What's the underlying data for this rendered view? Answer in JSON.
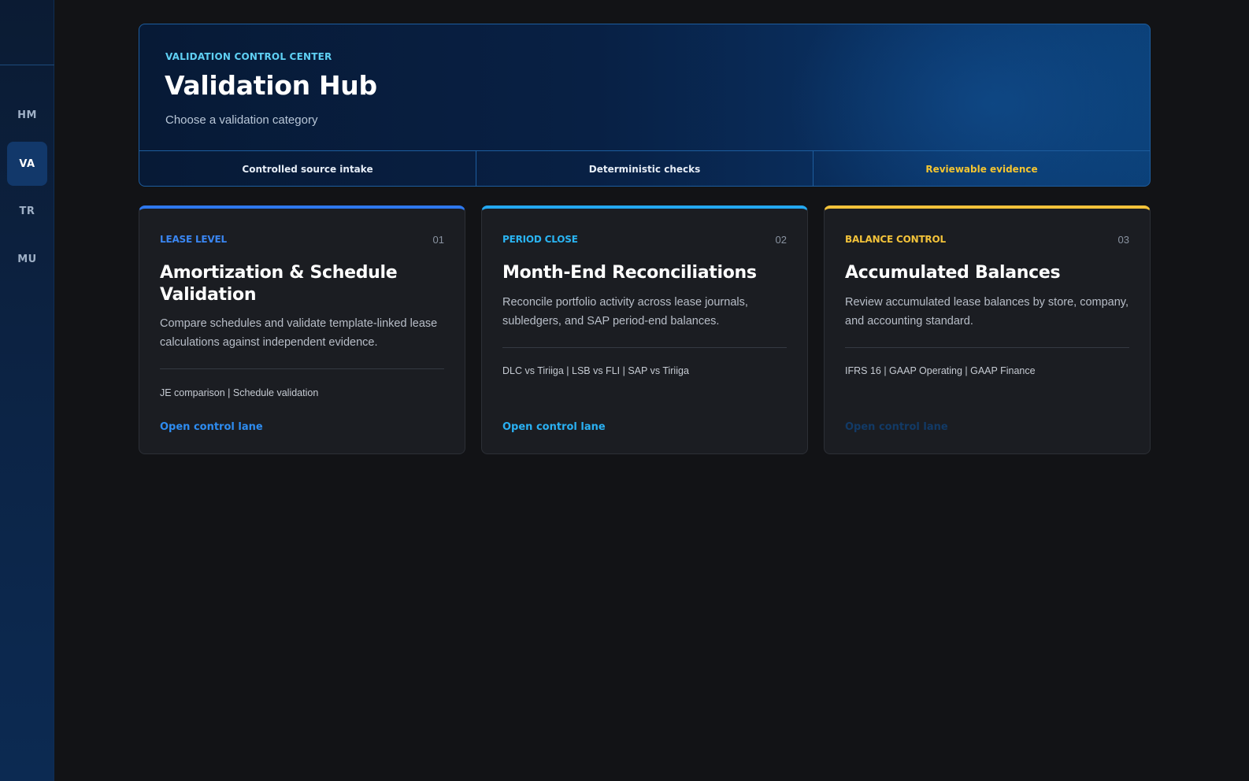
{
  "sidebar": {
    "items": [
      {
        "label": "HM"
      },
      {
        "label": "VA"
      },
      {
        "label": "TR"
      },
      {
        "label": "MU"
      }
    ]
  },
  "hero": {
    "eyebrow": "VALIDATION CONTROL CENTER",
    "title": "Validation Hub",
    "subtitle": "Choose a validation category",
    "pills": [
      {
        "label": "Controlled source intake"
      },
      {
        "label": "Deterministic checks"
      },
      {
        "label": "Reviewable evidence"
      }
    ]
  },
  "cards": [
    {
      "kicker": "LEASE LEVEL",
      "number": "01",
      "title": "Amortization & Schedule Validation",
      "description": "Compare schedules and validate template-linked lease calculations against independent evidence.",
      "tags": "JE comparison | Schedule validation",
      "link": "Open control lane",
      "accent": "#2e78ee"
    },
    {
      "kicker": "PERIOD CLOSE",
      "number": "02",
      "title": "Month-End Reconciliations",
      "description": "Reconcile portfolio activity across lease journals, subledgers, and SAP period-end balances.",
      "tags": "DLC vs Tiriiga | LSB vs FLI | SAP vs Tiriiga",
      "link": "Open control lane",
      "accent": "#24a8f0"
    },
    {
      "kicker": "BALANCE CONTROL",
      "number": "03",
      "title": "Accumulated Balances",
      "description": "Review accumulated lease balances by store, company, and accounting standard.",
      "tags": "IFRS 16 | GAAP Operating | GAAP Finance",
      "link": "Open control lane",
      "accent": "#f2c23a"
    }
  ],
  "colors": {
    "link_blue": "#2e8cf0",
    "link_cyan": "#2ab0f2",
    "link_dim": "#123a66",
    "kicker_blue": "#3a86f2",
    "kicker_cyan": "#2ab4f2",
    "kicker_gold": "#f2c23a"
  }
}
